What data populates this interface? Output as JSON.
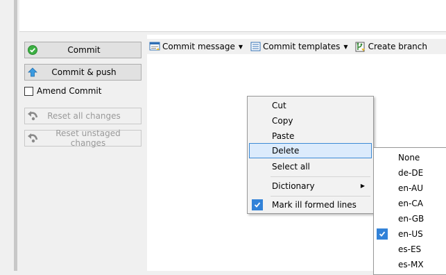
{
  "left": {
    "commit_label": "Commit",
    "commit_push_label": "Commit & push",
    "amend_label": "Amend Commit",
    "reset_all_label": "Reset all changes",
    "reset_unstaged_label": "Reset unstaged changes"
  },
  "toolbar": {
    "commit_message_label": "Commit message",
    "commit_templates_label": "Commit templates",
    "create_branch_label": "Create branch"
  },
  "context_menu": {
    "items": [
      "Cut",
      "Copy",
      "Paste",
      "Delete",
      "Select all"
    ],
    "highlighted": "Delete",
    "dictionary_label": "Dictionary",
    "mark_label": "Mark ill formed lines",
    "mark_checked": true
  },
  "dictionary_menu": {
    "items": [
      "None",
      "de-DE",
      "en-AU",
      "en-CA",
      "en-GB",
      "en-US",
      "es-ES",
      "es-MX"
    ],
    "checked": "en-US"
  },
  "colors": {
    "accent": "#3282d8",
    "highlight_bg": "#dcebfc",
    "highlight_border": "#3c8ad5"
  },
  "icons": {
    "commit": "green-check-icon",
    "commit_push": "up-arrow-icon",
    "reset": "undo-icon",
    "commit_message": "message-icon",
    "commit_templates": "template-icon",
    "create_branch": "branch-icon"
  }
}
